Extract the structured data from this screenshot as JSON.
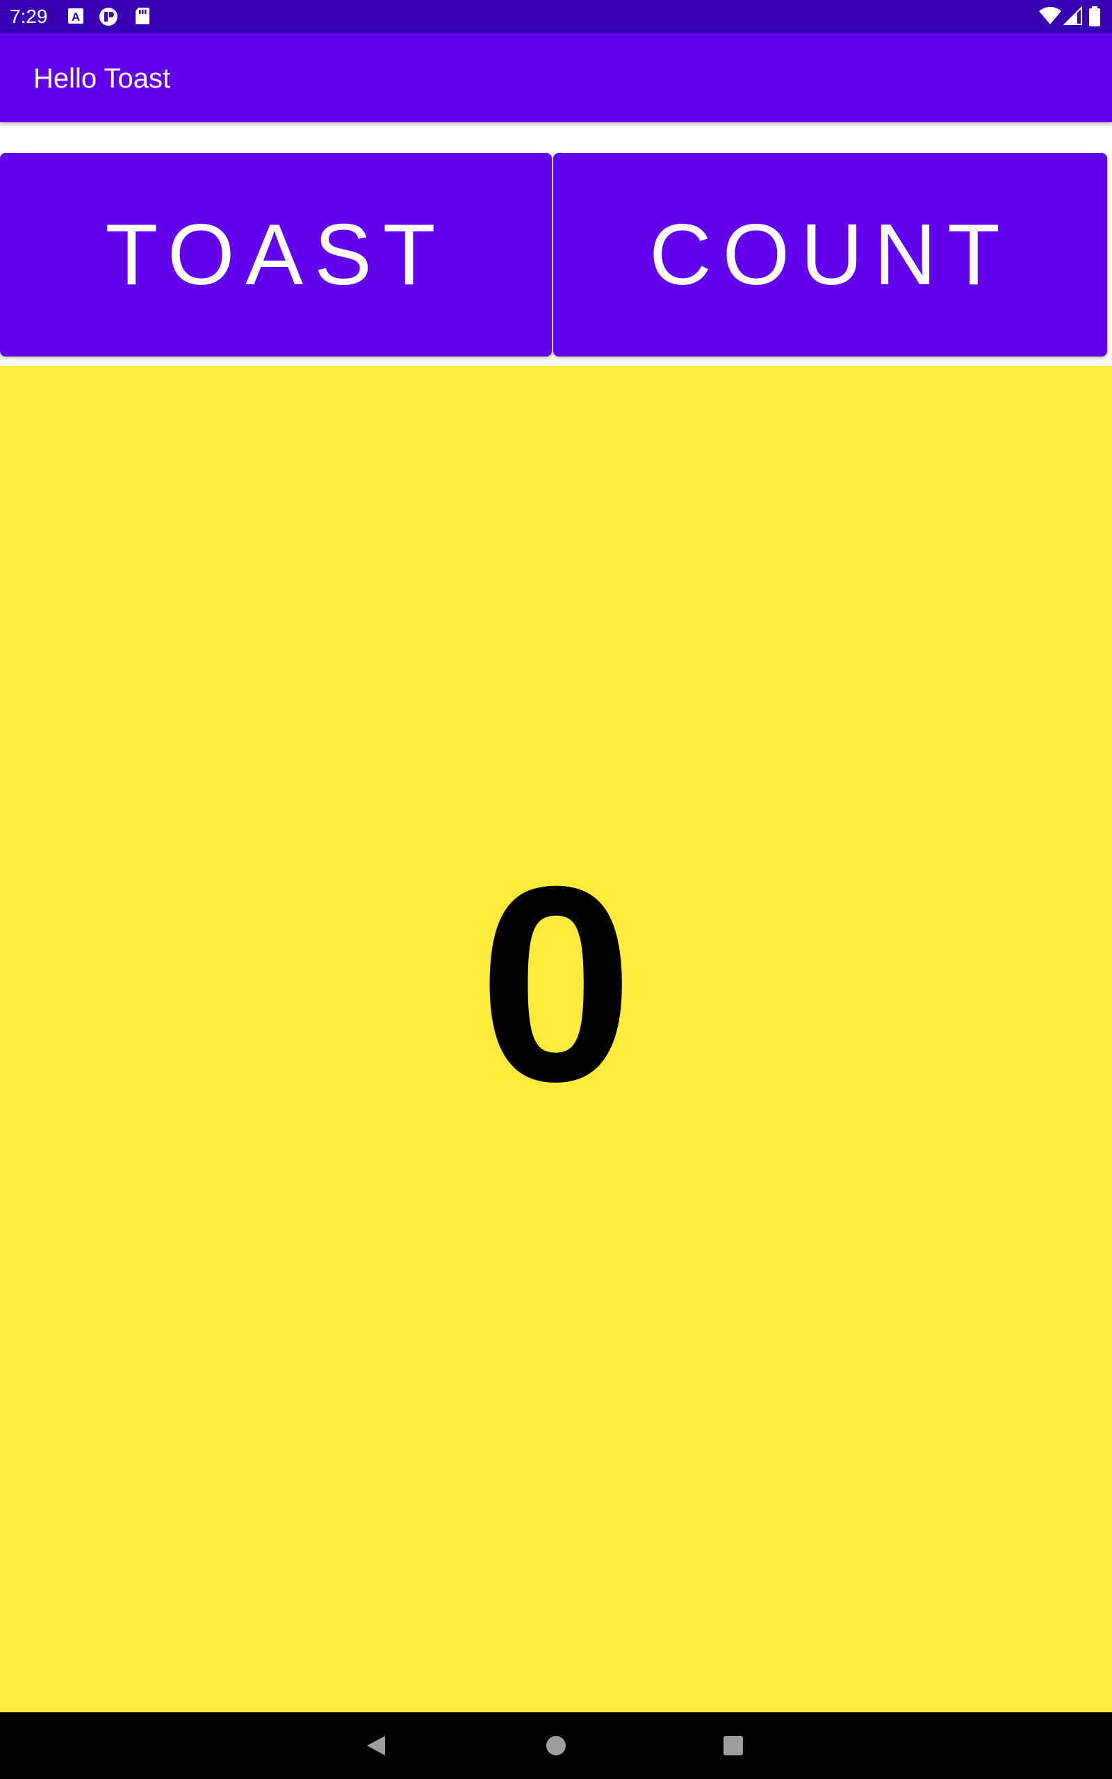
{
  "status_bar": {
    "time": "7:29",
    "left_icons": [
      "a-badge-icon",
      "circle-app-icon",
      "sd-card-icon"
    ],
    "right_icons": [
      "wifi-icon",
      "cell-signal-icon",
      "battery-icon"
    ]
  },
  "app_bar": {
    "title": "Hello Toast"
  },
  "buttons": {
    "toast_label": "TOAST",
    "count_label": "COUNT"
  },
  "counter": {
    "value": "0"
  },
  "nav_bar": {
    "icons": [
      "back-icon",
      "home-icon",
      "recents-icon"
    ]
  },
  "colors": {
    "status_bar": "#3700B3",
    "primary": "#6200EE",
    "count_background": "#FFEB3B",
    "nav_bar": "#000000"
  }
}
